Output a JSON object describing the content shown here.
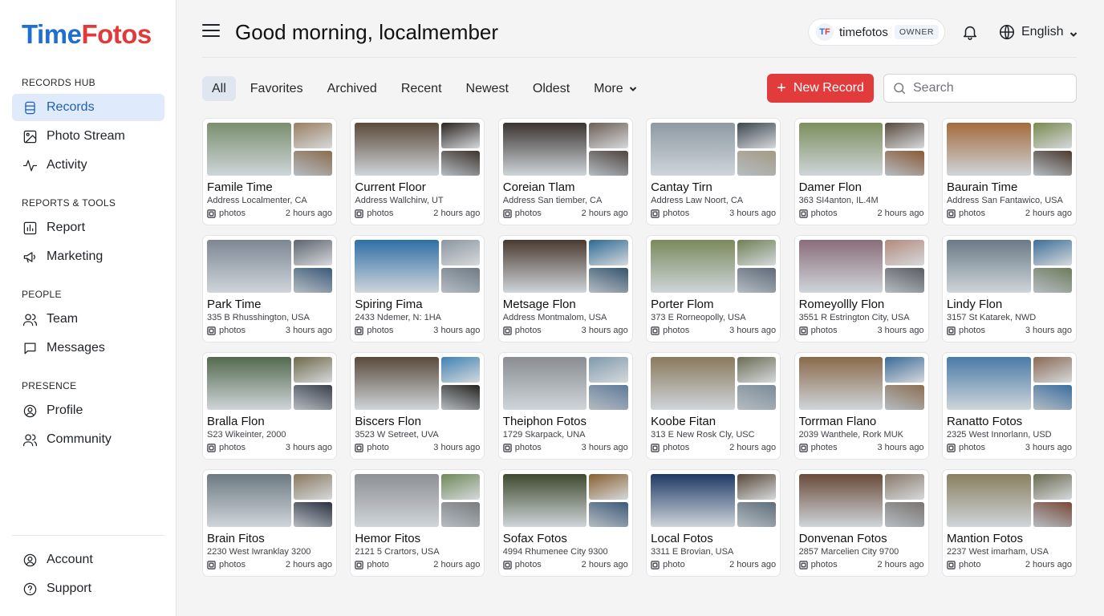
{
  "brand": {
    "part1": "Time",
    "part2": "Fotos",
    "colors": {
      "primary": "#1f6fd1",
      "accent": "#e03a3a"
    }
  },
  "sidebar": {
    "sections": [
      {
        "title": "RECORDS HUB",
        "items": [
          {
            "label": "Records",
            "icon": "database-icon",
            "active": true
          },
          {
            "label": "Photo Stream",
            "icon": "image-icon"
          },
          {
            "label": "Activity",
            "icon": "activity-icon"
          }
        ]
      },
      {
        "title": "REPORTS & TOOLS",
        "items": [
          {
            "label": "Report",
            "icon": "bar-chart-icon"
          },
          {
            "label": "Marketing",
            "icon": "megaphone-icon"
          }
        ]
      },
      {
        "title": "PEOPLE",
        "items": [
          {
            "label": "Team",
            "icon": "users-icon"
          },
          {
            "label": "Messages",
            "icon": "message-icon"
          }
        ]
      },
      {
        "title": "PRESENCE",
        "items": [
          {
            "label": "Profile",
            "icon": "user-circle-icon"
          },
          {
            "label": "Community",
            "icon": "users-icon"
          }
        ]
      }
    ],
    "footer": [
      {
        "label": "Account",
        "icon": "user-circle-icon"
      },
      {
        "label": "Support",
        "icon": "help-circle-icon"
      }
    ]
  },
  "header": {
    "greeting": "Good morning, localmember",
    "account": {
      "initials_1": "T",
      "initials_2": "F",
      "name": "timefotos",
      "role": "OWNER"
    },
    "language": "English"
  },
  "toolbar": {
    "tabs": [
      {
        "label": "All",
        "active": true
      },
      {
        "label": "Favorites"
      },
      {
        "label": "Archived"
      },
      {
        "label": "Recent"
      },
      {
        "label": "Newest"
      },
      {
        "label": "Oldest"
      },
      {
        "label": "More",
        "dropdown": true
      }
    ],
    "new_record_label": "New Record",
    "search_placeholder": "Search"
  },
  "records": [
    {
      "title": "Famile Time",
      "address": "Address Localmenter, CA",
      "media": "photos",
      "time": "2 hours ago",
      "colors": [
        "#7a8f6e",
        "#9a7f62",
        "#8b6d4f"
      ]
    },
    {
      "title": "Current Floor",
      "address": "Address Wallchirw, UT",
      "media": "photos",
      "time": "2 hours ago",
      "colors": [
        "#5b4a3a",
        "#2b2420",
        "#3e342c"
      ]
    },
    {
      "title": "Coreian Tlam",
      "address": "Address San tiember, CA",
      "media": "photos",
      "time": "2 hours ago",
      "colors": [
        "#3a3431",
        "#6d5f55",
        "#4e4540"
      ]
    },
    {
      "title": "Cantay Tirn",
      "address": "Address Law Noort, CA",
      "media": "photos",
      "time": "3 hours ago",
      "colors": [
        "#8d9aa3",
        "#3c4650",
        "#a59a84"
      ]
    },
    {
      "title": "Damer Flon",
      "address": "363 SI4anton, IL.4M",
      "media": "photos",
      "time": "2 hours ago",
      "colors": [
        "#7c8f5e",
        "#5a4a3d",
        "#8a5a36"
      ]
    },
    {
      "title": "Baurain Time",
      "address": "Address San Fantawico, USA",
      "media": "photos",
      "time": "2 hours ago",
      "colors": [
        "#a36b3c",
        "#7a8a4f",
        "#4a3a2e"
      ]
    },
    {
      "title": "Park Time",
      "address": "335 B Rhusshington, USA",
      "media": "photos",
      "time": "3 hours ago",
      "colors": [
        "#7d8794",
        "#5d6470",
        "#3b5a7a"
      ]
    },
    {
      "title": "Spiring Fima",
      "address": "2433 Ndemer, N: 1HA",
      "media": "photos",
      "time": "3 hours ago",
      "colors": [
        "#2f6fa6",
        "#8c96a0",
        "#6f7b86"
      ]
    },
    {
      "title": "Metsage Flon",
      "address": "Address Montmalom, USA",
      "media": "photos",
      "time": "3 hours ago",
      "colors": [
        "#4a3a30",
        "#2e6a96",
        "#35556e"
      ]
    },
    {
      "title": "Porter Flom",
      "address": "373 E Rorneopolly, USA",
      "media": "photos",
      "time": "3 hours ago",
      "colors": [
        "#7b8a5c",
        "#6f8055",
        "#5e6a78"
      ]
    },
    {
      "title": "Romeyollly Flon",
      "address": "3551 R Estrington City, USA",
      "media": "photos",
      "time": "3 hours ago",
      "colors": [
        "#8a6d7a",
        "#b48a7d",
        "#5a5c62"
      ]
    },
    {
      "title": "Lindy Flon",
      "address": "3157 St Katarek, NWD",
      "media": "photos",
      "time": "3 hours ago",
      "colors": [
        "#6a7a86",
        "#3d6f99",
        "#6e7c5d"
      ]
    },
    {
      "title": "Bralla Flon",
      "address": "S23 Wikeinter, 2000",
      "media": "photos",
      "time": "3 hours ago",
      "colors": [
        "#546a4e",
        "#6f6a4a",
        "#3a3f4a"
      ]
    },
    {
      "title": "Biscers Flon",
      "address": "3523 W Setreet, UVA",
      "media": "photo",
      "time": "3 hours ago",
      "colors": [
        "#5a4a3c",
        "#3e82b3",
        "#262320"
      ]
    },
    {
      "title": "Theiphon Fotos",
      "address": "1729 Skarpack, UNA",
      "media": "photos",
      "time": "3 hours ago",
      "colors": [
        "#8a8e93",
        "#7e9aad",
        "#5e7a9a"
      ]
    },
    {
      "title": "Koobe Fitan",
      "address": "313 E New Rosk Cly, USC",
      "media": "photos",
      "time": "2 hours ago",
      "colors": [
        "#8a7a5d",
        "#6b6d55",
        "#7a8c9a"
      ]
    },
    {
      "title": "Torrman Flano",
      "address": "2039 Wanthele, Rork MUK",
      "media": "photes",
      "time": "3 hours ago",
      "colors": [
        "#8a6a4a",
        "#3b6a99",
        "#8c6e52"
      ]
    },
    {
      "title": "Ranatto Fotos",
      "address": "2325 West Innorlann, USD",
      "media": "photos",
      "time": "3 hours ago",
      "colors": [
        "#4a7aa8",
        "#8a6a55",
        "#3a6ea0"
      ]
    },
    {
      "title": "Brain Fitos",
      "address": "2230 West Iwranklay 3200",
      "media": "photos",
      "time": "2 hours ago",
      "colors": [
        "#6d7a82",
        "#8a7a60",
        "#2a3040"
      ]
    },
    {
      "title": "Hemor Fitos",
      "address": "2121 5 Crartors, USA",
      "media": "photo",
      "time": "2 hours ago",
      "colors": [
        "#8d9094",
        "#6f8a5a",
        "#7a7d80"
      ]
    },
    {
      "title": "Sofax Fotos",
      "address": "4994 Rhumenee City 9300",
      "media": "photos",
      "time": "2 hours ago",
      "colors": [
        "#3f4a2e",
        "#8a6030",
        "#3d5a7a"
      ]
    },
    {
      "title": "Local Fotos",
      "address": "3311 E Brovian, USA",
      "media": "photo",
      "time": "2 hours ago",
      "colors": [
        "#1f3a66",
        "#5a4a3a",
        "#5e6e7a"
      ]
    },
    {
      "title": "Donvenan Fotos",
      "address": "2857 Marcelien City 9700",
      "media": "photos",
      "time": "2 hours ago",
      "colors": [
        "#6a4a3a",
        "#8a7a6a",
        "#7a7470"
      ]
    },
    {
      "title": "Mantion Fotos",
      "address": "2237 West imarham, USA",
      "media": "photo",
      "time": "2 hours ago",
      "colors": [
        "#8a8060",
        "#6a6a50",
        "#7a4a3a"
      ]
    }
  ]
}
